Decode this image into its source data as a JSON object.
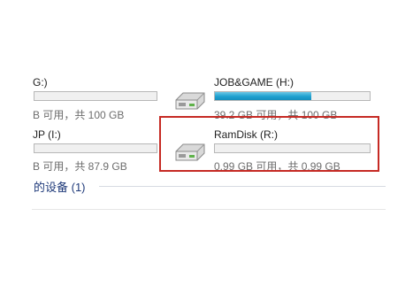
{
  "drives": [
    {
      "name": "G:)",
      "used_fraction": 0.0,
      "space_text": "B 可用，共 100 GB"
    },
    {
      "name": "JOB&GAME (H:)",
      "used_fraction": 0.62,
      "space_text": "39.2 GB 可用，共 100 GB"
    },
    {
      "name": "JP (I:)",
      "used_fraction": 0.0,
      "space_text": "B 可用，共 87.9 GB"
    },
    {
      "name": "RamDisk (R:)",
      "used_fraction": 0.0,
      "space_text": "0.99 GB 可用，共 0.99 GB"
    }
  ],
  "section_title": "的设备 (1)",
  "colors": {
    "bar_fill": "#1fa0cf",
    "highlight_border": "#c62a24"
  }
}
